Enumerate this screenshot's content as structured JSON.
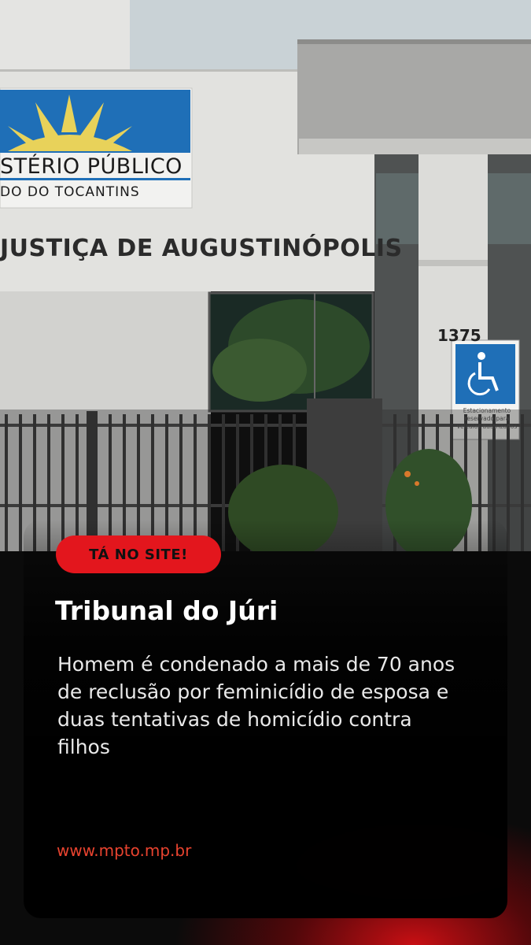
{
  "photo": {
    "sign_line1": "STÉRIO PÚBLICO",
    "sign_line2": "DO DO TOCANTINS",
    "building_name": "JUSTIÇA DE AUGUSTINÓPOLIS",
    "street_number": "1375",
    "parking_sign": "Estacionamento reservado para veículos autorizados"
  },
  "badge": {
    "label": "TÁ NO SITE!"
  },
  "headline": {
    "category": "Tribunal do Júri",
    "body": "Homem é condenado a mais de 70 anos de reclusão por feminicídio de esposa e duas tentativas de homicídio contra filhos"
  },
  "footer": {
    "url": "www.mpto.mp.br"
  },
  "colors": {
    "badge": "#e3161d",
    "url": "#e8432f",
    "sign_blue": "#1f6fb7",
    "sun": "#e8d25a"
  }
}
